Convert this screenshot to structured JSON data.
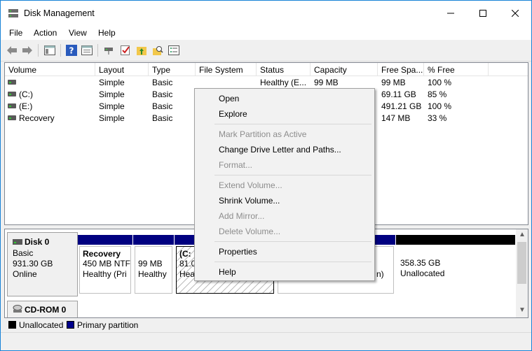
{
  "window": {
    "title": "Disk Management"
  },
  "menu": [
    "File",
    "Action",
    "View",
    "Help"
  ],
  "toolbar": {
    "icons": [
      "back-arrow-icon",
      "forward-arrow-icon",
      "console-tree-icon",
      "help-icon",
      "properties-icon",
      "connect-icon",
      "check-icon",
      "folder-up-icon",
      "search-folder-icon",
      "list-icon"
    ]
  },
  "volumes": {
    "columns": [
      "Volume",
      "Layout",
      "Type",
      "File System",
      "Status",
      "Capacity",
      "Free Spa...",
      "% Free"
    ],
    "rows": [
      {
        "volume": "",
        "layout": "Simple",
        "type": "Basic",
        "fs": "",
        "status": "Healthy (E...",
        "capacity": "99 MB",
        "free": "99 MB",
        "pct": "100 %"
      },
      {
        "volume": "(C:)",
        "layout": "Simple",
        "type": "Basic",
        "fs": "",
        "status": "",
        "capacity": "",
        "free": "69.11 GB",
        "pct": "85 %"
      },
      {
        "volume": "(E:)",
        "layout": "Simple",
        "type": "Basic",
        "fs": "",
        "status": "",
        "capacity": "",
        "free": "491.21 GB",
        "pct": "100 %"
      },
      {
        "volume": "Recovery",
        "layout": "Simple",
        "type": "Basic",
        "fs": "",
        "status": "",
        "capacity": "",
        "free": "147 MB",
        "pct": "33 %"
      }
    ]
  },
  "disk0": {
    "name": "Disk 0",
    "type": "Basic",
    "size": "931.30 GB",
    "state": "Online",
    "partitions": [
      {
        "title": "Recovery",
        "line1": "450 MB NTF",
        "line2": "Healthy (Pri"
      },
      {
        "title": "",
        "line1": "99 MB",
        "line2": "Healthy"
      },
      {
        "title": "(C:",
        "line1": "81.0",
        "line2": "Hea"
      },
      {
        "title": "",
        "line1": "",
        "line2": "n)"
      },
      {
        "title": "",
        "line1": "358.35 GB",
        "line2": "Unallocated"
      }
    ]
  },
  "cdrom": {
    "name": "CD-ROM 0"
  },
  "legend": {
    "unallocated": "Unallocated",
    "primary": "Primary partition",
    "colors": {
      "unallocated": "#000000",
      "primary": "#00008b"
    }
  },
  "context_menu": {
    "open": "Open",
    "explore": "Explore",
    "mark_active": "Mark Partition as Active",
    "change_letter": "Change Drive Letter and Paths...",
    "format": "Format...",
    "extend": "Extend Volume...",
    "shrink": "Shrink Volume...",
    "add_mirror": "Add Mirror...",
    "delete": "Delete Volume...",
    "properties": "Properties",
    "help": "Help"
  },
  "colors": {
    "partition_bar": "#000080",
    "unallocated_bar": "#000000",
    "accent": "#1883d7"
  }
}
